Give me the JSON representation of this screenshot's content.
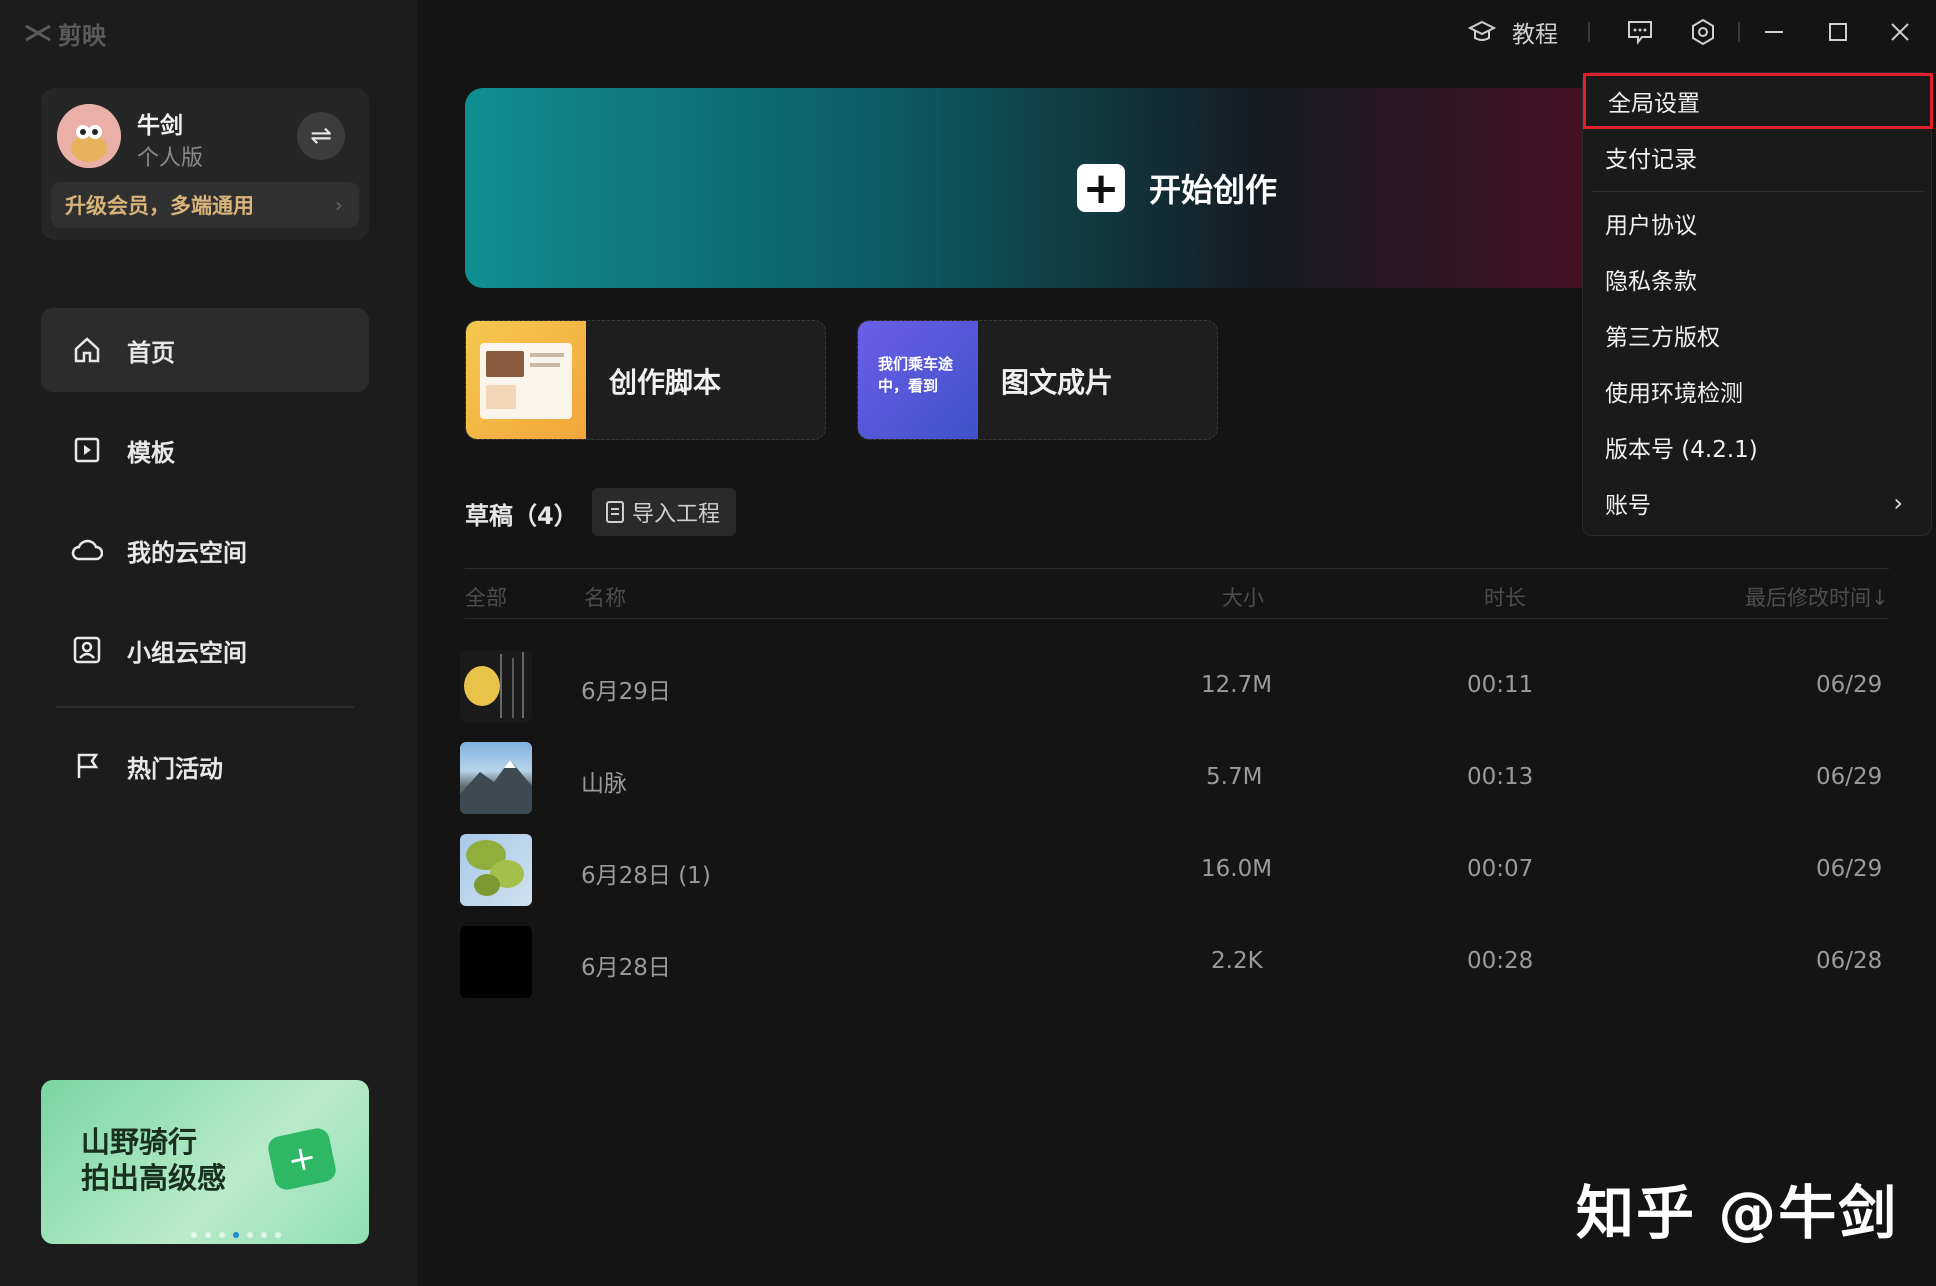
{
  "app": {
    "logo_text": "剪映"
  },
  "user": {
    "name": "牛剑",
    "plan": "个人版",
    "upgrade_label": "升级会员，多端通用"
  },
  "nav": [
    {
      "label": "首页",
      "icon": "home-icon",
      "active": true
    },
    {
      "label": "模板",
      "icon": "template-icon",
      "active": false
    },
    {
      "label": "我的云空间",
      "icon": "cloud-icon",
      "active": false
    },
    {
      "label": "小组云空间",
      "icon": "group-cloud-icon",
      "active": false
    },
    {
      "label": "热门活动",
      "icon": "flag-icon",
      "active": false
    }
  ],
  "banner": {
    "line1": "山野骑行",
    "line2": "拍出高级感"
  },
  "topbar": {
    "tutorial_label": "教程"
  },
  "hero": {
    "label": "开始创作"
  },
  "quick": [
    {
      "label": "创作脚本",
      "thumb_text": ""
    },
    {
      "label": "图文成片",
      "thumb_text": "我们乘车途中，看到"
    }
  ],
  "drafts": {
    "title": "草稿（4）",
    "import_label": "导入工程",
    "headers": {
      "all": "全部",
      "name": "名称",
      "size": "大小",
      "duration": "时长",
      "modified": "最后修改时间↓"
    },
    "rows": [
      {
        "name": "6月29日",
        "size": "12.7M",
        "duration": "00:11",
        "modified": "06/29"
      },
      {
        "name": "山脉",
        "size": "5.7M",
        "duration": "00:13",
        "modified": "06/29"
      },
      {
        "name": "6月28日 (1)",
        "size": "16.0M",
        "duration": "00:07",
        "modified": "06/29"
      },
      {
        "name": "6月28日",
        "size": "2.2K",
        "duration": "00:28",
        "modified": "06/28"
      }
    ]
  },
  "menu": {
    "items": [
      {
        "label": "全局设置",
        "highlight": true
      },
      {
        "label": "支付记录"
      },
      {
        "label": "用户协议"
      },
      {
        "label": "隐私条款"
      },
      {
        "label": "第三方版权"
      },
      {
        "label": "使用环境检测"
      },
      {
        "label": "版本号 (4.2.1)"
      },
      {
        "label": "账号",
        "submenu": true
      }
    ]
  },
  "watermark": "知乎 @牛剑",
  "colors": {
    "highlight_border": "#e0202c",
    "upgrade_gold": "#d8b47a"
  }
}
